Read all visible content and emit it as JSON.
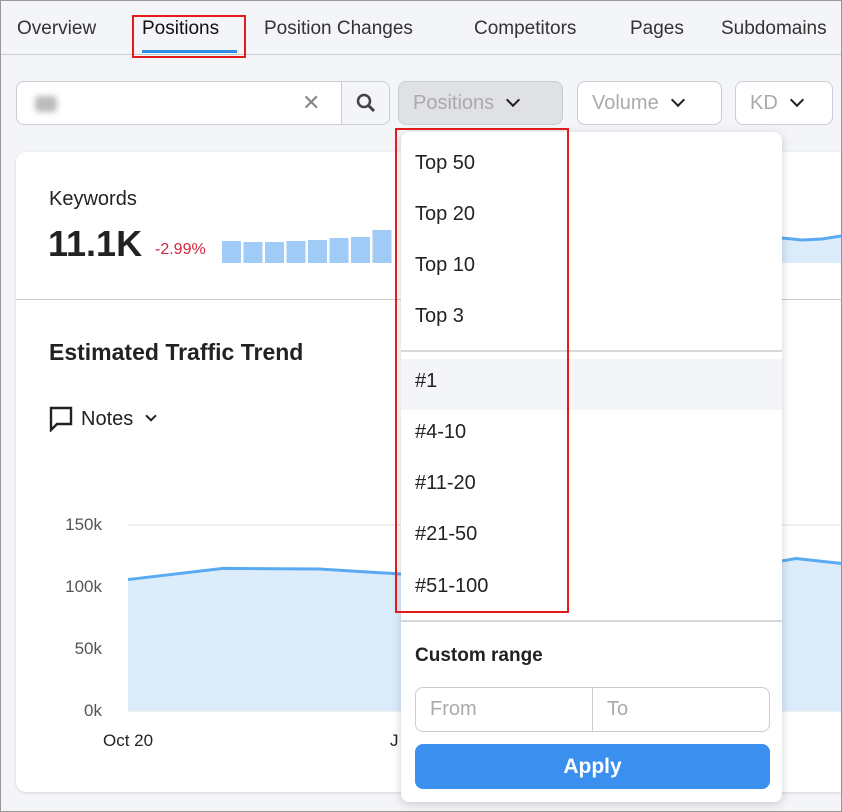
{
  "tabs": [
    "Overview",
    "Positions",
    "Position Changes",
    "Competitors",
    "Pages",
    "Subdomains"
  ],
  "active_tab": "Positions",
  "filters": {
    "search_value": "",
    "positions_label": "Positions",
    "volume_label": "Volume",
    "kd_label": "KD"
  },
  "keywords": {
    "label": "Keywords",
    "value": "11.1K",
    "change": "-2.99%",
    "trend_bars": [
      22,
      21,
      21,
      22,
      23,
      25,
      26,
      33
    ]
  },
  "traffic": {
    "title": "Estimated Traffic Trend",
    "notes_label": "Notes",
    "y_ticks": [
      "150k",
      "100k",
      "50k",
      "0k"
    ],
    "x_ticks": [
      "Oct 20",
      "J"
    ],
    "series": [
      106000,
      115000,
      114500,
      110000
    ]
  },
  "positions_menu": {
    "items": [
      "Top 50",
      "Top 20",
      "Top 10",
      "Top 3"
    ],
    "ranges": [
      "#1",
      "#4-10",
      "#11-20",
      "#21-50",
      "#51-100"
    ],
    "custom_range_label": "Custom range",
    "from_placeholder": "From",
    "to_placeholder": "To",
    "apply_label": "Apply"
  },
  "colors": {
    "accent": "#3b8fef",
    "negative": "#d0243b",
    "chart_line": "#5aaaf2",
    "chart_fill": "#dcecfb",
    "highlight": "#e41b1b"
  }
}
